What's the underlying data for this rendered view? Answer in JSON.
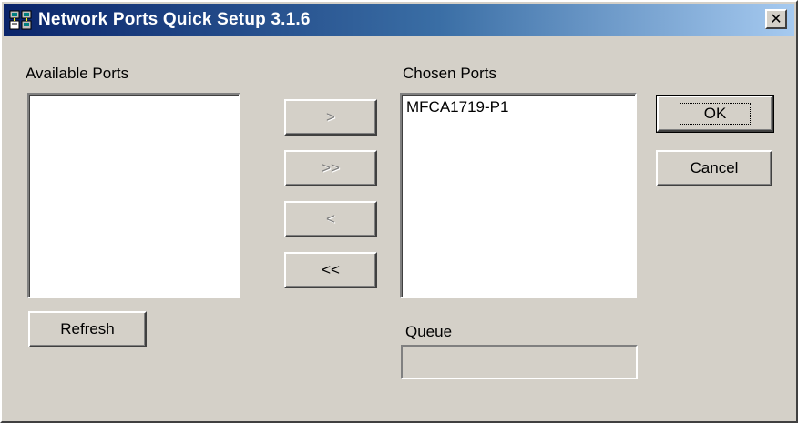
{
  "window": {
    "title": "Network Ports Quick Setup 3.1.6",
    "close_glyph": "✕"
  },
  "available_ports": {
    "label": "Available Ports",
    "items": []
  },
  "chosen_ports": {
    "label": "Chosen Ports",
    "items": [
      "MFCA1719-P1"
    ]
  },
  "move_buttons": {
    "add_one": ">",
    "add_all": ">>",
    "remove_one": "<",
    "remove_all": "<<"
  },
  "actions": {
    "ok_label": "OK",
    "cancel_label": "Cancel",
    "refresh_label": "Refresh"
  },
  "queue": {
    "label": "Queue",
    "value": ""
  },
  "colors": {
    "title_gradient_start": "#0a246a",
    "title_gradient_end": "#a6caf0",
    "face": "#d4d0c8"
  }
}
